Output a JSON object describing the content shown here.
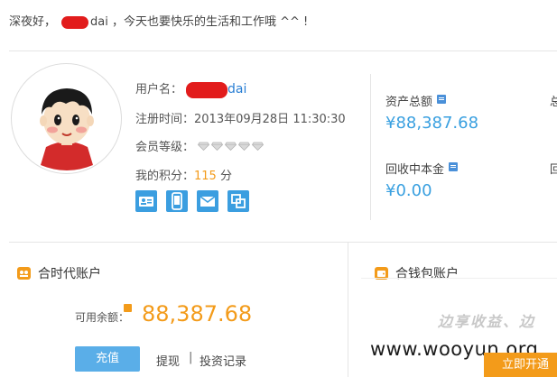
{
  "greeting": {
    "prefix": "深夜好，",
    "name_suffix": "dai",
    "message": "，今天也要快乐的生活和工作哦 ^^ !"
  },
  "profile": {
    "username_label": "用户名：",
    "username_suffix": "dai",
    "register_label": "注册时间：",
    "register_value": "2013年09月28日 11:30:30",
    "level_label": "会员等级：",
    "level_diamonds": 5,
    "points_label": "我的积分：",
    "points_value": "115",
    "points_unit": "分",
    "quick_icons": [
      "id-card-icon",
      "mobile-icon",
      "mail-icon",
      "bank-card-icon"
    ]
  },
  "assets": {
    "total_label": "资产总额",
    "total_value": "¥88,387.68",
    "receivable_label": "回收中本金",
    "receivable_value": "¥0.00",
    "cut_total_label": "总",
    "cut_receivable_label": "回"
  },
  "heshidai": {
    "title": "合时代账户",
    "balance_label": "可用余额：",
    "balance_value": "88,387.68",
    "recharge_label": "充值",
    "withdraw_label": "提现",
    "separator": "|",
    "records_label": "投资记录"
  },
  "wallet": {
    "title": "合钱包账户",
    "slogan": "边享收益、边",
    "open_label": "立即开通"
  },
  "watermark": "www.wooyun.org",
  "colors": {
    "accent_blue": "#3aa0e0",
    "accent_orange": "#f39b1a",
    "button_blue": "#5aaee8",
    "redaction": "#e21c1c"
  }
}
